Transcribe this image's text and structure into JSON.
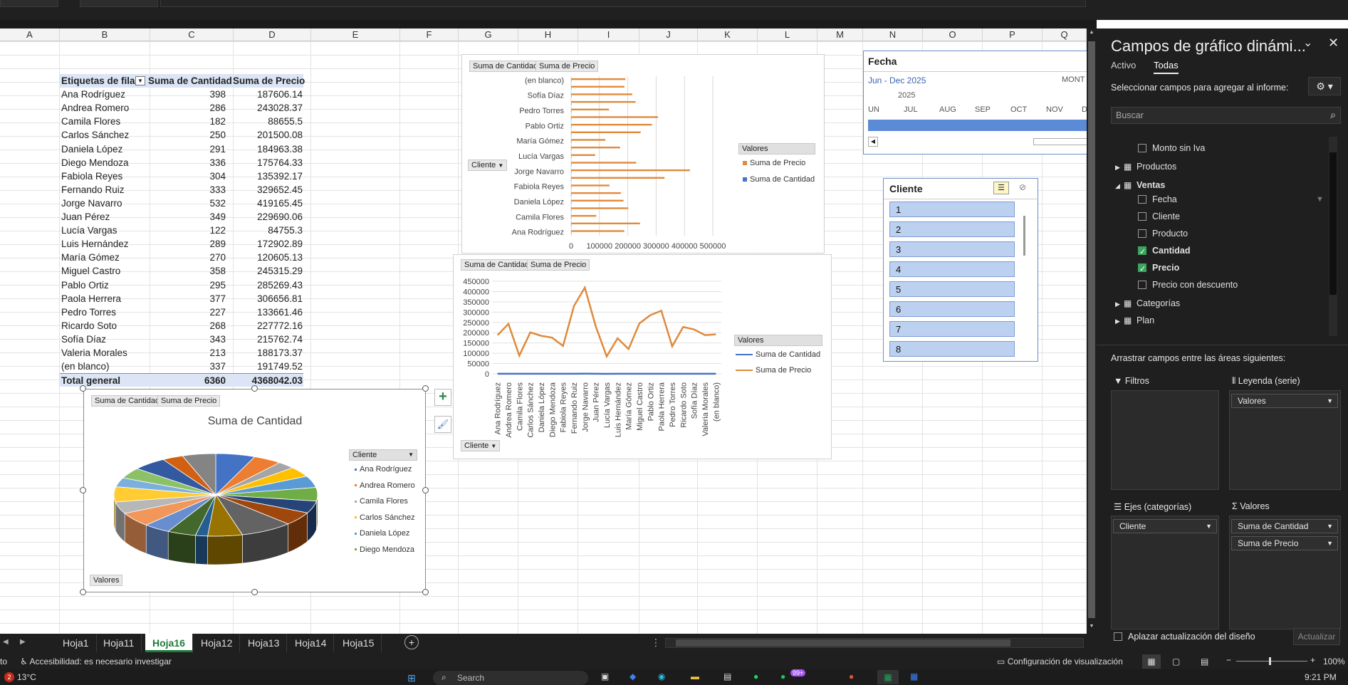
{
  "columns": [
    "A",
    "B",
    "C",
    "D",
    "E",
    "F",
    "G",
    "H",
    "I",
    "J",
    "K",
    "L",
    "M",
    "N",
    "O",
    "P",
    "Q"
  ],
  "pivot": {
    "headers": [
      "Etiquetas de fila",
      "Suma de Cantidad",
      "Suma de Precio"
    ],
    "rows": [
      [
        "Ana Rodríguez",
        "398",
        "187606.14"
      ],
      [
        "Andrea Romero",
        "286",
        "243028.37"
      ],
      [
        "Camila Flores",
        "182",
        "88655.5"
      ],
      [
        "Carlos Sánchez",
        "250",
        "201500.08"
      ],
      [
        "Daniela López",
        "291",
        "184963.38"
      ],
      [
        "Diego Mendoza",
        "336",
        "175764.33"
      ],
      [
        "Fabiola Reyes",
        "304",
        "135392.17"
      ],
      [
        "Fernando Ruiz",
        "333",
        "329652.45"
      ],
      [
        "Jorge Navarro",
        "532",
        "419165.45"
      ],
      [
        "Juan Pérez",
        "349",
        "229690.06"
      ],
      [
        "Lucía Vargas",
        "122",
        "84755.3"
      ],
      [
        "Luis Hernández",
        "289",
        "172902.89"
      ],
      [
        "María Gómez",
        "270",
        "120605.13"
      ],
      [
        "Miguel Castro",
        "358",
        "245315.29"
      ],
      [
        "Pablo Ortiz",
        "295",
        "285269.43"
      ],
      [
        "Paola Herrera",
        "377",
        "306656.81"
      ],
      [
        "Pedro Torres",
        "227",
        "133661.46"
      ],
      [
        "Ricardo Soto",
        "268",
        "227772.16"
      ],
      [
        "Sofía Díaz",
        "343",
        "215762.74"
      ],
      [
        "Valeria Morales",
        "213",
        "188173.37"
      ],
      [
        "(en blanco)",
        "337",
        "191749.52"
      ]
    ],
    "total": [
      "Total general",
      "6360",
      "4368042.03"
    ]
  },
  "chart_data": [
    {
      "type": "bar",
      "orientation": "horizontal",
      "field_buttons": [
        "Suma de Cantidad",
        "Suma de Precio"
      ],
      "axis_button": "Cliente",
      "categories": [
        "Ana Rodríguez",
        "Andrea Romero",
        "Camila Flores",
        "Carlos Sánchez",
        "Daniela López",
        "Diego Mendoza",
        "Fabiola Reyes",
        "Fernando Ruiz",
        "Jorge Navarro",
        "Juan Pérez",
        "Lucía Vargas",
        "Luis Hernández",
        "María Gómez",
        "Miguel Castro",
        "Pablo Ortiz",
        "Paola Herrera",
        "Pedro Torres",
        "Ricardo Soto",
        "Sofía Díaz",
        "Valeria Morales",
        "(en blanco)"
      ],
      "category_tick_labels": [
        "Ana Rodríguez",
        "Camila Flores",
        "Daniela López",
        "Fabiola Reyes",
        "Jorge Navarro",
        "Lucía Vargas",
        "María Gómez",
        "Pablo Ortiz",
        "Pedro Torres",
        "Sofía Díaz",
        "(en blanco)"
      ],
      "x_ticks": [
        "0",
        "100000",
        "200000",
        "300000",
        "400000",
        "500000"
      ],
      "xlim": [
        0,
        500000
      ],
      "legend_title": "Valores",
      "series": [
        {
          "name": "Suma de Precio",
          "color": "#e08a3c",
          "values": [
            187606.14,
            243028.37,
            88655.5,
            201500.08,
            184963.38,
            175764.33,
            135392.17,
            329652.45,
            419165.45,
            229690.06,
            84755.3,
            172902.89,
            120605.13,
            245315.29,
            285269.43,
            306656.81,
            133661.46,
            227772.16,
            215762.74,
            188173.37,
            191749.52
          ]
        },
        {
          "name": "Suma de Cantidad",
          "color": "#4472c4",
          "values": [
            398,
            286,
            182,
            250,
            291,
            336,
            304,
            333,
            532,
            349,
            122,
            289,
            270,
            358,
            295,
            377,
            227,
            268,
            343,
            213,
            337
          ]
        }
      ]
    },
    {
      "type": "line",
      "field_buttons": [
        "Suma de Cantidad",
        "Suma de Precio"
      ],
      "axis_button": "Cliente",
      "categories": [
        "Ana Rodríguez",
        "Andrea Romero",
        "Camila Flores",
        "Carlos Sánchez",
        "Daniela López",
        "Diego Mendoza",
        "Fabiola Reyes",
        "Fernando Ruiz",
        "Jorge Navarro",
        "Juan Pérez",
        "Lucía Vargas",
        "Luis Hernández",
        "María Gómez",
        "Miguel Castro",
        "Pablo Ortiz",
        "Paola Herrera",
        "Pedro Torres",
        "Ricardo Soto",
        "Sofía Díaz",
        "Valeria Morales",
        "(en blanco)"
      ],
      "y_ticks": [
        "450000",
        "400000",
        "350000",
        "300000",
        "250000",
        "200000",
        "150000",
        "100000",
        "50000",
        "0"
      ],
      "ylim": [
        0,
        450000
      ],
      "legend_title": "Valores",
      "series": [
        {
          "name": "Suma de Cantidad",
          "color": "#4472c4",
          "values": [
            398,
            286,
            182,
            250,
            291,
            336,
            304,
            333,
            532,
            349,
            122,
            289,
            270,
            358,
            295,
            377,
            227,
            268,
            343,
            213,
            337
          ]
        },
        {
          "name": "Suma de Precio",
          "color": "#e08a3c",
          "values": [
            187606.14,
            243028.37,
            88655.5,
            201500.08,
            184963.38,
            175764.33,
            135392.17,
            329652.45,
            419165.45,
            229690.06,
            84755.3,
            172902.89,
            120605.13,
            245315.29,
            285269.43,
            306656.81,
            133661.46,
            227772.16,
            215762.74,
            188173.37,
            191749.52
          ]
        }
      ]
    },
    {
      "type": "pie",
      "title": "Suma de Cantidad",
      "field_buttons": [
        "Suma de Cantidad",
        "Suma de Precio"
      ],
      "values_button": "Valores",
      "legend_title": "Cliente",
      "legend_visible": [
        "Ana Rodríguez",
        "Andrea Romero",
        "Camila Flores",
        "Carlos Sánchez",
        "Daniela López",
        "Diego Mendoza"
      ],
      "categories": [
        "Ana Rodríguez",
        "Andrea Romero",
        "Camila Flores",
        "Carlos Sánchez",
        "Daniela López",
        "Diego Mendoza",
        "Fabiola Reyes",
        "Fernando Ruiz",
        "Jorge Navarro",
        "Juan Pérez",
        "Lucía Vargas",
        "Luis Hernández",
        "María Gómez",
        "Miguel Castro",
        "Pablo Ortiz",
        "Paola Herrera",
        "Pedro Torres",
        "Ricardo Soto",
        "Sofía Díaz",
        "Valeria Morales",
        "(en blanco)"
      ],
      "values": [
        398,
        286,
        182,
        250,
        291,
        336,
        304,
        333,
        532,
        349,
        122,
        289,
        270,
        358,
        295,
        377,
        227,
        268,
        343,
        213,
        337
      ],
      "colors": [
        "#4472c4",
        "#ed7d31",
        "#a5a5a5",
        "#ffc000",
        "#5b9bd5",
        "#70ad47",
        "#264478",
        "#9e480e",
        "#636363",
        "#997300",
        "#255e91",
        "#43682b",
        "#698ed0",
        "#f1975a",
        "#b7b7b7",
        "#ffcd33",
        "#7cafdd",
        "#8cc168",
        "#335aa1",
        "#d26012",
        "#848484"
      ]
    }
  ],
  "timeline": {
    "title": "Fecha",
    "range": "Jun - Dec 2025",
    "level": "MONT",
    "year": "2025",
    "months": [
      "UN",
      "JUL",
      "AUG",
      "SEP",
      "OCT",
      "NOV",
      "DEC"
    ]
  },
  "slicer": {
    "title": "Cliente",
    "items": [
      "1",
      "2",
      "3",
      "4",
      "5",
      "6",
      "7",
      "8"
    ]
  },
  "panel": {
    "title": "Campos de gráfico dinámi...",
    "tabs": [
      "Activo",
      "Todas"
    ],
    "instruction": "Seleccionar campos para agregar al informe:",
    "search_placeholder": "Buscar",
    "fields": [
      {
        "label": "Monto sin Iva",
        "kind": "check",
        "checked": false
      },
      {
        "label": "Productos",
        "kind": "table"
      },
      {
        "label": "Ventas",
        "kind": "table-open"
      },
      {
        "label": "Fecha",
        "kind": "check",
        "checked": false
      },
      {
        "label": "Cliente",
        "kind": "check",
        "checked": false
      },
      {
        "label": "Producto",
        "kind": "check",
        "checked": false
      },
      {
        "label": "Cantidad",
        "kind": "check",
        "checked": true
      },
      {
        "label": "Precio",
        "kind": "check",
        "checked": true
      },
      {
        "label": "Precio con descuento",
        "kind": "check",
        "checked": false
      },
      {
        "label": "Categorías",
        "kind": "table"
      },
      {
        "label": "Plan",
        "kind": "table"
      }
    ],
    "areas_instruction": "Arrastrar campos entre las áreas siguientes:",
    "area_filters": "Filtros",
    "area_legend": "Leyenda (serie)",
    "area_legend_items": [
      "Valores"
    ],
    "area_axis": "Ejes (categorías)",
    "area_axis_items": [
      "Cliente"
    ],
    "area_values": "Valores",
    "area_values_items": [
      "Suma de Cantidad",
      "Suma de Precio"
    ],
    "defer_label": "Aplazar actualización del diseño",
    "update_label": "Actualizar"
  },
  "sheets": {
    "tabs": [
      "Hoja1",
      "Hoja11",
      "Hoja16",
      "Hoja12",
      "Hoja13",
      "Hoja14",
      "Hoja15"
    ],
    "active": "Hoja16"
  },
  "status": {
    "left": "to",
    "accessibility": "Accesibilidad: es necesario investigar",
    "display_settings": "Configuración de visualización",
    "zoom": "100%"
  },
  "taskbar": {
    "temperature": "13°C",
    "badge": "2",
    "search": "Search",
    "notif": "99+",
    "time": "9:21 PM"
  }
}
